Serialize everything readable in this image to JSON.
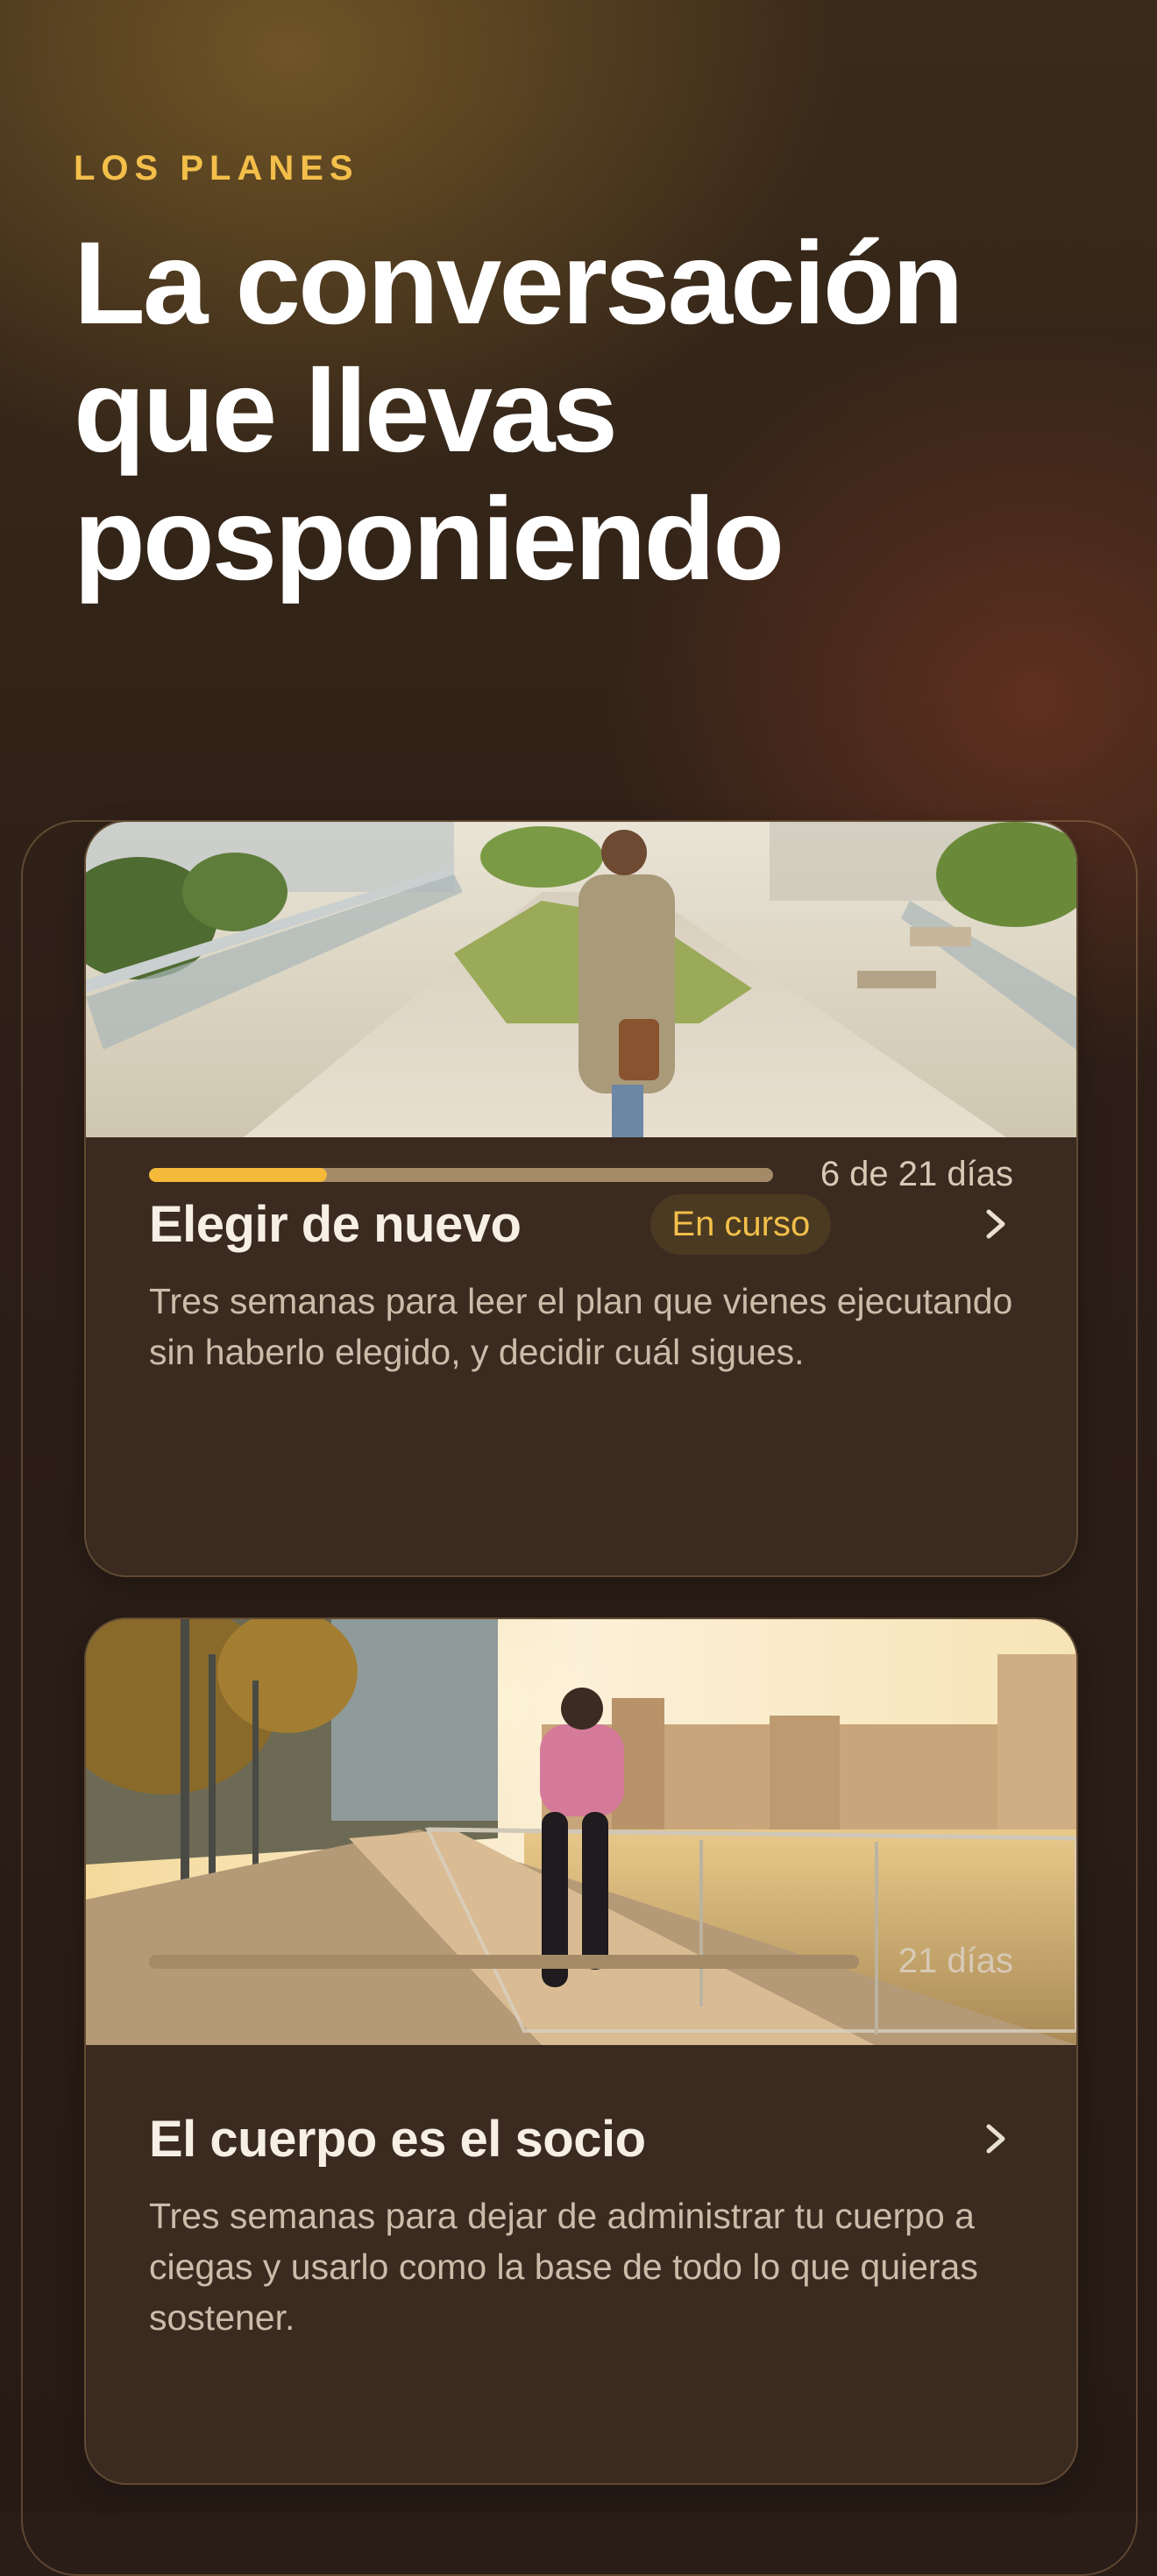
{
  "header": {
    "eyebrow": "LOS PLANES",
    "title": "La conversación que llevas posponiendo"
  },
  "plans": [
    {
      "title": "Elegir de nuevo",
      "status": "En curso",
      "description": "Tres semanas para leer el plan que vienes ejecutando sin haberlo elegido, y decidir cuál sigues.",
      "progress_label": "6 de 21 días",
      "progress": {
        "current_day": 6,
        "total_days": 21
      },
      "image": "woman-walking-garden-path-photo"
    },
    {
      "title": "El cuerpo es el socio",
      "description": "Tres semanas para dejar de administrar tu cuerpo a ciegas y usarlo como la base de todo lo que quieras sostener.",
      "progress_label": "21 días",
      "progress": {
        "current_day": 0,
        "total_days": 21
      },
      "image": "woman-running-riverside-photo"
    }
  ],
  "colors": {
    "accent": "#f3bf4a",
    "background": "#2a1c16",
    "card": "#3a2a1f",
    "progress_track": "#a58a68"
  }
}
